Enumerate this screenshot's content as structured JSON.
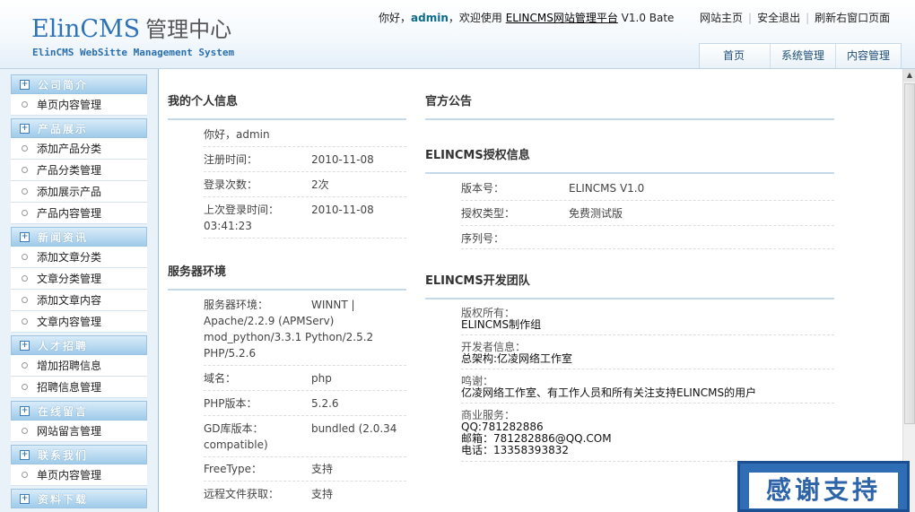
{
  "header": {
    "logo_en": "ElinCMS",
    "logo_cn": "管理中心",
    "logo_sub": "ElinCMS WebSitte Management System",
    "welcome_prefix": "你好，",
    "user": "admin",
    "welcome_mid": "，欢迎使用 ",
    "platform": "ELINCMS网站管理平台",
    "version": " V1.0 Bate",
    "links": [
      "网站主页",
      "安全退出",
      "刷新右窗口页面"
    ],
    "tabs": [
      "首页",
      "系统管理",
      "内容管理"
    ]
  },
  "sidebar": {
    "categories": [
      {
        "label": "公司简介",
        "items": [
          "单页内容管理"
        ]
      },
      {
        "label": "产品展示",
        "items": [
          "添加产品分类",
          "产品分类管理",
          "添加展示产品",
          "产品内容管理"
        ]
      },
      {
        "label": "新闻资讯",
        "items": [
          "添加文章分类",
          "文章分类管理",
          "添加文章内容",
          "文章内容管理"
        ]
      },
      {
        "label": "人才招聘",
        "items": [
          "增加招聘信息",
          "招聘信息管理"
        ]
      },
      {
        "label": "在线留言",
        "items": [
          "网站留言管理"
        ]
      },
      {
        "label": "联系我们",
        "items": [
          "单页内容管理"
        ]
      },
      {
        "label": "资料下载",
        "items": []
      }
    ]
  },
  "personal": {
    "title": "我的个人信息",
    "greeting": "你好，admin",
    "reg_label": "注册时间：",
    "reg_value": "2010-11-08",
    "login_count_label": "登录次数：",
    "login_count_value": "2次",
    "last_login_label": "上次登录时间：",
    "last_login_value": "2010-11-08",
    "last_login_time": "03:41:23"
  },
  "server": {
    "title": "服务器环境",
    "env_label": "服务器环境：",
    "env_value_1": "WINNT |",
    "env_value_2": "Apache/2.2.9 (APMServ)",
    "env_value_3": "mod_python/3.3.1 Python/2.5.2",
    "env_value_4": "PHP/5.2.6",
    "domain_label": "域名：",
    "domain_value": "php",
    "php_label": "PHP版本：",
    "php_value": "5.2.6",
    "gd_label": "GD库版本：",
    "gd_value_1": "bundled (2.0.34",
    "gd_value_2": "compatible)",
    "freetype_label": "FreeType：",
    "freetype_value": "支持",
    "remote_label": "远程文件获取：",
    "remote_value": "支持"
  },
  "notice": {
    "title": "官方公告"
  },
  "license": {
    "title": "ELINCMS授权信息",
    "version_label": "版本号：",
    "version_value": "ELINCMS V1.0",
    "type_label": "授权类型：",
    "type_value": "免费测试版",
    "serial_label": "序列号："
  },
  "team": {
    "title": "ELINCMS开发团队",
    "copyright_label": "版权所有：",
    "copyright_value": "ELINCMS制作组",
    "dev_label": "开发者信息：",
    "dev_value": "总架构:亿凌网络工作室",
    "thanks_label": "鸣谢：",
    "thanks_value": "亿凌网络工作室、有工作人员和所有关注支持ELINCMS的用户",
    "biz_label": "商业服务：",
    "qq": "QQ:781282886",
    "email": "邮箱：781282886@QQ.COM",
    "phone": "电话：13358393832"
  },
  "badge": {
    "text": "感谢支持"
  }
}
